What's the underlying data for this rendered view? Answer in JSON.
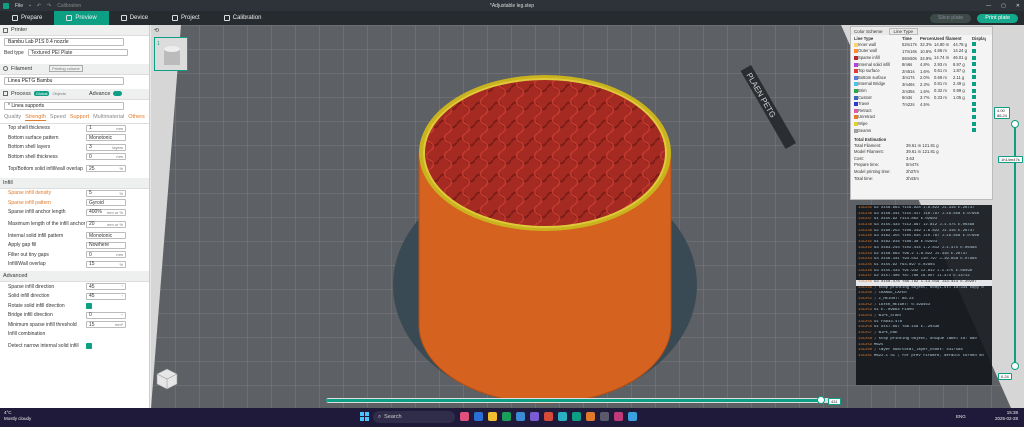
{
  "titlebar": {
    "menu_file": "File",
    "menu_calibration": "Calibration",
    "title": "*Adjustable leg.step"
  },
  "tabs": [
    {
      "label": "Prepare"
    },
    {
      "label": "Preview"
    },
    {
      "label": "Device"
    },
    {
      "label": "Project"
    },
    {
      "label": "Calibration"
    }
  ],
  "actions": {
    "slice": "Slice plate",
    "print": "Print plate"
  },
  "printer": {
    "section": "Printer",
    "name": "Bambu Lab P1S 0.4 nozzle",
    "bed_label": "Bed type",
    "bed_value": "Textured PEI Plate"
  },
  "filament": {
    "section": "Filament",
    "button": "Printing volume",
    "name": "Linea PETG Bambu"
  },
  "process": {
    "section": "Process",
    "mode_global": "Global",
    "mode_objects": "Objects",
    "advance": "Advance",
    "profile": "* Linea supports"
  },
  "tabs2": [
    "Quality",
    "Strength",
    "Speed",
    "Support",
    "Multimaterial",
    "Others"
  ],
  "shell": [
    {
      "label": "Top shell thickness",
      "value": "1",
      "unit": "mm"
    },
    {
      "label": "Bottom surface pattern",
      "value": "Monotonic",
      "unit": ""
    },
    {
      "label": "Bottom shell layers",
      "value": "3",
      "unit": "layers"
    },
    {
      "label": "Bottom shell thickness",
      "value": "0",
      "unit": "mm"
    },
    {
      "label": "Top/Bottom solid infill/wall overlap",
      "value": "25",
      "unit": "%"
    }
  ],
  "infill_section": "Infill",
  "infill": [
    {
      "label": "Sparse infill density",
      "value": "5",
      "unit": "%"
    },
    {
      "label": "Sparse infill pattern",
      "value": "Gyroid",
      "unit": ""
    },
    {
      "label": "Sparse infill anchor length",
      "value": "400%",
      "unit": "mm or %"
    },
    {
      "label": "Maximum length of the infill anchor",
      "value": "20",
      "unit": "mm or %"
    },
    {
      "label": "Internal solid infill pattern",
      "value": "Monotonic",
      "unit": ""
    },
    {
      "label": "Apply gap fill",
      "value": "Nowhere",
      "unit": ""
    },
    {
      "label": "Filter out tiny gaps",
      "value": "0",
      "unit": "mm"
    },
    {
      "label": "Infill/Wall overlap",
      "value": "15",
      "unit": "%"
    }
  ],
  "advanced_section": "Advanced",
  "advanced": [
    {
      "label": "Sparse infill direction",
      "value": "45",
      "unit": "°"
    },
    {
      "label": "Solid infill direction",
      "value": "45",
      "unit": "°"
    },
    {
      "label": "Rotate solid infill direction",
      "value": "",
      "unit": ""
    },
    {
      "label": "Bridge infill direction",
      "value": "0",
      "unit": "°"
    },
    {
      "label": "Minimum sparse infill threshold",
      "value": "15",
      "unit": "mm²"
    },
    {
      "label": "Infill combination",
      "value": "",
      "unit": ""
    },
    {
      "label": "Detect narrow internal solid infill",
      "value": "",
      "unit": ""
    }
  ],
  "color_panel": {
    "title": "Color Scheme",
    "scheme": "Line Type",
    "headers": [
      "Line Type",
      "Time",
      "Percent",
      "Used filament",
      "Display"
    ],
    "rows": [
      {
        "name": "Inner wall",
        "time": "52m17s",
        "pct": "32.3%",
        "len": "14.80 m",
        "w": "44.78 g",
        "color": "#ffd36a"
      },
      {
        "name": "Outer wall",
        "time": "17m16s",
        "pct": "10.6%",
        "len": "4.66 m",
        "w": "14.24 g",
        "color": "#ff8c2a"
      },
      {
        "name": "Sparse infill",
        "time": "56m50s",
        "pct": "34.9%",
        "len": "14.74 m",
        "w": "46.01 g",
        "color": "#b52a2a"
      },
      {
        "name": "Internal solid infill",
        "time": "8m6s",
        "pct": "4.8%",
        "len": "2.93 m",
        "w": "8.97 g",
        "color": "#b344e0"
      },
      {
        "name": "Top surface",
        "time": "2m51s",
        "pct": "1.6%",
        "len": "0.61 m",
        "w": "1.87 g",
        "color": "#e23a3a"
      },
      {
        "name": "Bottom surface",
        "time": "3m17s",
        "pct": "2.0%",
        "len": "0.69 m",
        "w": "2.11 g",
        "color": "#5a7de0"
      },
      {
        "name": "Internal Bridge",
        "time": "3m46s",
        "pct": "2.3%",
        "len": "0.81 m",
        "w": "2.49 g",
        "color": "#4ac4e6"
      },
      {
        "name": "Brim",
        "time": "2m35s",
        "pct": "1.6%",
        "len": "0.32 m",
        "w": "0.99 g",
        "color": "#2aa84a"
      },
      {
        "name": "Custom",
        "time": "6m3s",
        "pct": "3.7%",
        "len": "0.33 m",
        "w": "1.05 g",
        "color": "#3a6ab8"
      },
      {
        "name": "Travel",
        "time": "7m22s",
        "pct": "4.5%",
        "len": "",
        "w": "",
        "color": "#2a3acc"
      },
      {
        "name": "Retract",
        "time": "",
        "pct": "",
        "len": "",
        "w": "",
        "color": "#e05aa8"
      },
      {
        "name": "Unretract",
        "time": "",
        "pct": "",
        "len": "",
        "w": "",
        "color": "#e87a2a"
      },
      {
        "name": "Wipe",
        "time": "",
        "pct": "",
        "len": "",
        "w": "",
        "color": "#e0d02a"
      },
      {
        "name": "Seams",
        "time": "",
        "pct": "",
        "len": "",
        "w": "",
        "color": "#a0a0a0"
      }
    ],
    "estimation_title": "Total Estimation",
    "estimation": [
      {
        "k": "Total Filament:",
        "v": "39.61 m    121.81 g"
      },
      {
        "k": "Model Filament:",
        "v": "39.61 m    121.81 g"
      },
      {
        "k": "Cost:",
        "v": "3.63"
      },
      {
        "k": "Prepare time:",
        "v": "5m47s"
      },
      {
        "k": "Model printing time:",
        "v": "2h37m"
      },
      {
        "k": "Total time:",
        "v": "2h43m"
      }
    ]
  },
  "gcode": [
    {
      "n": "131235",
      "t": "G2 X158.663 Y116.828 I-8.822 J1.316 E.26737"
    },
    {
      "n": "131236",
      "t": "G3 X156.341 Y115.417 I10.797 J-19.658 E.07968"
    },
    {
      "n": "131237",
      "t": "G1 X155.92 Y114.862 E.02903"
    },
    {
      "n": "131238",
      "t": "G3 X155.433 Y112.997 I2.812 J-1.475 E.06498"
    },
    {
      "n": "131239",
      "t": "G2 X160.253 Y106.349 I-8.822 J1.316 E.26737"
    },
    {
      "n": "131240",
      "t": "G3 X162.355 Y105.035 I10.797 J-19.658 E.07968"
    },
    {
      "n": "131241",
      "t": "G1 X162.916 Y106.38 E.02903"
    },
    {
      "n": "131242",
      "t": "G3 X163.243 Y102.414 I-2.812 J-1.475 E.06498"
    },
    {
      "n": "131243",
      "t": "G2 X158.663 Y96.2 I-8.822 J1.316 E.26737"
    },
    {
      "n": "131244",
      "t": "G3 X156.341 Y94.552 I10.797 J-19.658 E.07968"
    },
    {
      "n": "131245",
      "t": "G1 X155.92 Y93.897 E.02903"
    },
    {
      "n": "131246",
      "t": "G3 X155.433 Y91.932 I2.812 J-1.475 E.06498"
    },
    {
      "n": "131247",
      "t": "G2 X157.406 Y87.766 I8.907 J1.374 E.14712"
    },
    {
      "n": "131248",
      "t": "G3 X158.478 Y88.792 I-13.019 J13.414 E.20207",
      "hl": true
    },
    {
      "n": "131249",
      "t": "; stop printing object, body1.stl id:334 copy 0"
    },
    {
      "n": "131250",
      "t": "; CHANGE_LAYER"
    },
    {
      "n": "131251",
      "t": "; Z_HEIGHT: 86.24"
    },
    {
      "n": "131252",
      "t": "; LAYER_HEIGHT: 0.199463"
    },
    {
      "n": "131253",
      "t": "G1 E-.09664 F1800"
    },
    {
      "n": "131254",
      "t": "; WIPE_START"
    },
    {
      "n": "131255",
      "t": "G1 F8843.478"
    },
    {
      "n": "131256",
      "t": "G1 X157.897 Y88.158 E-.20336"
    },
    {
      "n": "131257",
      "t": "; WIPE_END"
    },
    {
      "n": "131258",
      "t": "; stop printing object, unique label id: 680"
    },
    {
      "n": "131259",
      "t": "M625"
    },
    {
      "n": "131260",
      "t": "; layer num/total_layer_count: 431/588"
    },
    {
      "n": "131261",
      "t": "M622.1 S1 ; for prev firware, default turned on"
    }
  ],
  "slider": {
    "top_label": "4.00",
    "top_sub": "86.24",
    "mid_label": "1h14m47s",
    "bottom_label": "0.24",
    "progress": 0.97,
    "pos_label": "431"
  },
  "search": "Search",
  "weather": {
    "temp": "4°C",
    "desc": "Mostly cloudy"
  },
  "clock": {
    "time": "15:38",
    "date": "2025-02-28"
  },
  "lang": "ENG"
}
